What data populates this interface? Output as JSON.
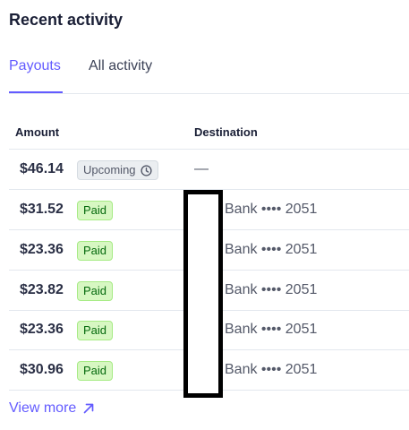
{
  "header": {
    "title": "Recent activity"
  },
  "tabs": [
    {
      "label": "Payouts",
      "active": true
    },
    {
      "label": "All activity",
      "active": false
    }
  ],
  "table": {
    "columns": {
      "amount": "Amount",
      "destination": "Destination"
    },
    "rows": [
      {
        "amount": "$46.14",
        "status": "Upcoming",
        "status_icon": "clock-icon",
        "destination": "—"
      },
      {
        "amount": "$31.52",
        "status": "Paid",
        "destination": "Bank •••• 2051"
      },
      {
        "amount": "$23.36",
        "status": "Paid",
        "destination": "Bank •••• 2051"
      },
      {
        "amount": "$23.82",
        "status": "Paid",
        "destination": "Bank •••• 2051"
      },
      {
        "amount": "$23.36",
        "status": "Paid",
        "destination": "Bank •••• 2051"
      },
      {
        "amount": "$30.96",
        "status": "Paid",
        "destination": "Bank •••• 2051"
      }
    ]
  },
  "footer": {
    "view_more_label": "View more",
    "view_more_icon": "arrow-up-right-icon"
  },
  "colors": {
    "accent": "#635bff",
    "paid_bg": "#d7f7c2",
    "paid_text": "#05690d",
    "upcoming_bg": "#ebeef1"
  }
}
